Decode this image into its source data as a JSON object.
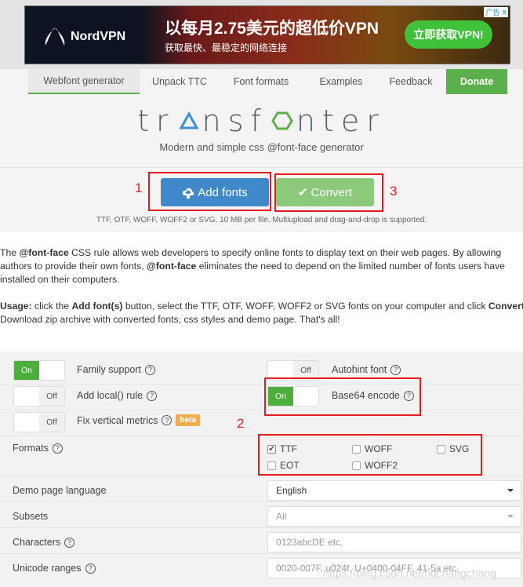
{
  "ad": {
    "brand": "NordVPN",
    "headline": "以每月2.75美元的超低价VPN",
    "sub": "获取最快、最稳定的网络连接",
    "cta": "立即获取VPN!",
    "tag": "广告",
    "close": "X"
  },
  "nav": {
    "items": [
      {
        "label": "Webfont generator",
        "active": true
      },
      {
        "label": "Unpack TTC"
      },
      {
        "label": "Font formats"
      },
      {
        "label": "Examples"
      },
      {
        "label": "Feedback"
      },
      {
        "label": "Donate"
      }
    ]
  },
  "logo": {
    "text": "transfonter",
    "part1": "tr",
    "part2": "nsf",
    "part3": "nter",
    "triangle_color": "#3a8fd6",
    "hexagon_color": "#5bb04b"
  },
  "tagline": "Modern and simple css @font-face generator",
  "actions": {
    "add_fonts": "Add fonts",
    "convert": "Convert",
    "hint": "TTF, OTF, WOFF, WOFF2 or SVG, 10 MB per file. Multiupload and drag-and-drop is supported.",
    "annotations": [
      "1",
      "2",
      "3"
    ],
    "add_color": "#3f88c9",
    "convert_color": "#8cc97a"
  },
  "description": {
    "p1a": "The ",
    "p1b": "@font-face",
    "p1c": " CSS rule allows web developers to specify online fonts to display text on their web pages. By allowing",
    "p2a": "authors to provide their own fonts, ",
    "p2b": "@font-face",
    "p2c": " eliminates the need to depend on the limited number of fonts users have",
    "p3": "installed on their computers.",
    "u1": "Usage:",
    "u2": " click the ",
    "u3": "Add font(s)",
    "u4": " button, select the TTF, OTF, WOFF, WOFF2 or SVG fonts on your computer and click ",
    "u5": "Convert",
    "u6": "Download zip archive with converted fonts, css styles and demo page. That's all!"
  },
  "options": {
    "on": "On",
    "off": "Off",
    "help": "?",
    "family_support": {
      "label": "Family support",
      "value": "On"
    },
    "autohint": {
      "label": "Autohint font",
      "value": "Off"
    },
    "add_local": {
      "label": "Add local() rule",
      "value": "Off"
    },
    "base64": {
      "label": "Base64 encode",
      "value": "On"
    },
    "fix_vertical": {
      "label": "Fix vertical metrics",
      "value": "Off",
      "badge": "beta"
    },
    "formats": {
      "label": "Formats",
      "items": [
        {
          "label": "TTF",
          "checked": true
        },
        {
          "label": "WOFF",
          "checked": false
        },
        {
          "label": "SVG",
          "checked": false
        },
        {
          "label": "EOT",
          "checked": false
        },
        {
          "label": "WOFF2",
          "checked": false
        }
      ]
    },
    "demo_language": {
      "label": "Demo page language",
      "value": "English"
    },
    "subsets": {
      "label": "Subsets",
      "value": "All"
    },
    "characters": {
      "label": "Characters",
      "placeholder": "0123abcDE etc."
    },
    "unicode": {
      "label": "Unicode ranges",
      "placeholder": "0020-007F, u024f, U+0400-04FF, 41-5a etc."
    }
  },
  "watermark": "https://blog.csdn.net/hdchangchang"
}
